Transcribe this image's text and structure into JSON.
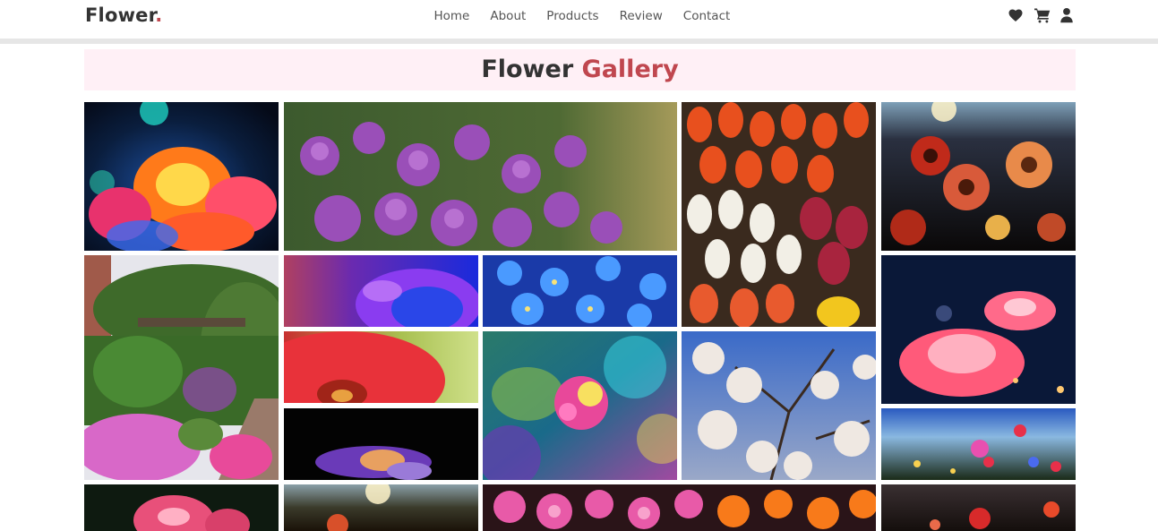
{
  "brand": {
    "name": "Flower",
    "dot": "."
  },
  "nav": {
    "links": [
      "Home",
      "About",
      "Products",
      "Review",
      "Contact"
    ],
    "icons": [
      "heart-icon",
      "cart-icon",
      "user-icon"
    ]
  },
  "gallery": {
    "title_word": "Flower",
    "title_accent": "Gallery"
  },
  "colors": {
    "accent": "#c0474f",
    "header_bg": "#fff0f6",
    "text": "#333333"
  }
}
